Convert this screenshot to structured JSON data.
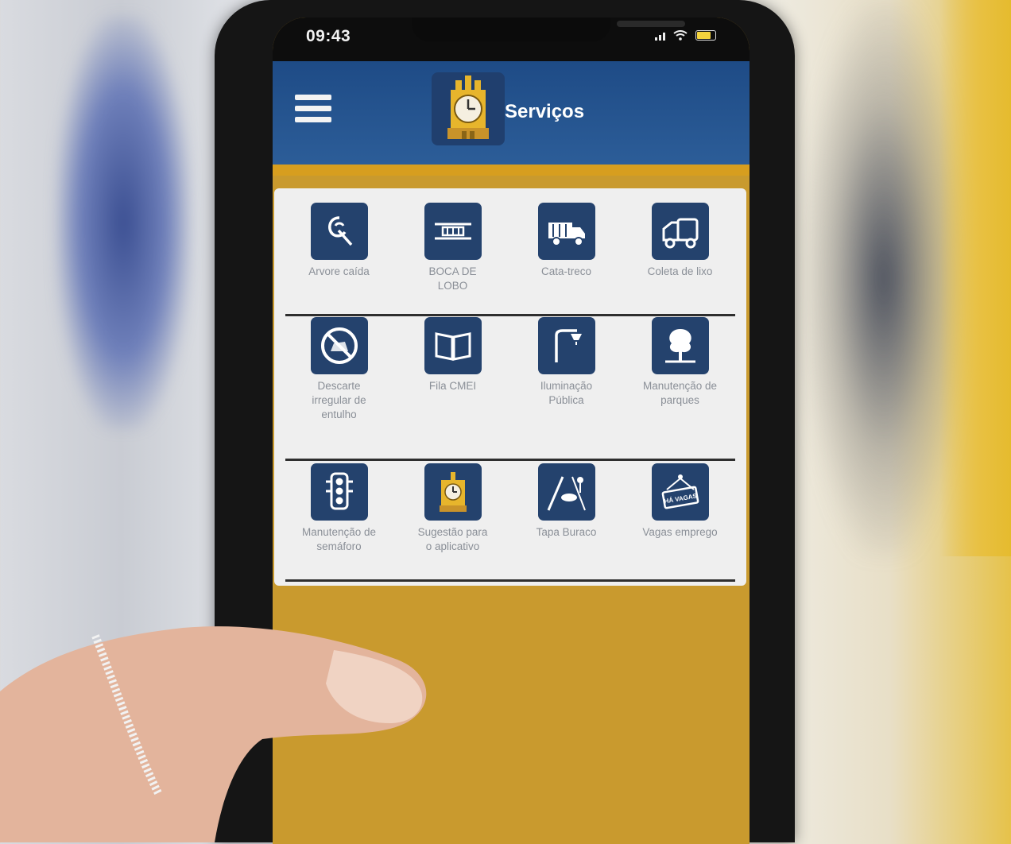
{
  "statusbar": {
    "time": "09:43"
  },
  "header": {
    "title": "Serviços"
  },
  "services": [
    {
      "label": "Arvore caída",
      "icon": "tree-fallen-icon"
    },
    {
      "label": "BOCA DE LOBO",
      "icon": "storm-drain-icon"
    },
    {
      "label": "Cata-treco",
      "icon": "truck-icon"
    },
    {
      "label": "Coleta de lixo",
      "icon": "garbage-truck-icon"
    },
    {
      "label": "Descarte irregular de entulho",
      "icon": "no-dumping-icon"
    },
    {
      "label": "Fila CMEI",
      "icon": "book-icon"
    },
    {
      "label": "Iluminação Pública",
      "icon": "street-lamp-icon"
    },
    {
      "label": "Manutenção de parques",
      "icon": "park-tree-icon"
    },
    {
      "label": "Manutenção de semáforo",
      "icon": "traffic-light-icon"
    },
    {
      "label": "Sugestão para o aplicativo",
      "icon": "clock-tower-icon"
    },
    {
      "label": "Tapa Buraco",
      "icon": "pothole-icon"
    },
    {
      "label": "Vagas emprego",
      "icon": "job-sign-icon"
    }
  ],
  "hanging_sign_text": "HÁ VAGAS",
  "colors": {
    "header_blue": "#1e4b86",
    "accent_gold": "#c99a2e",
    "tile_navy": "#24426d"
  }
}
